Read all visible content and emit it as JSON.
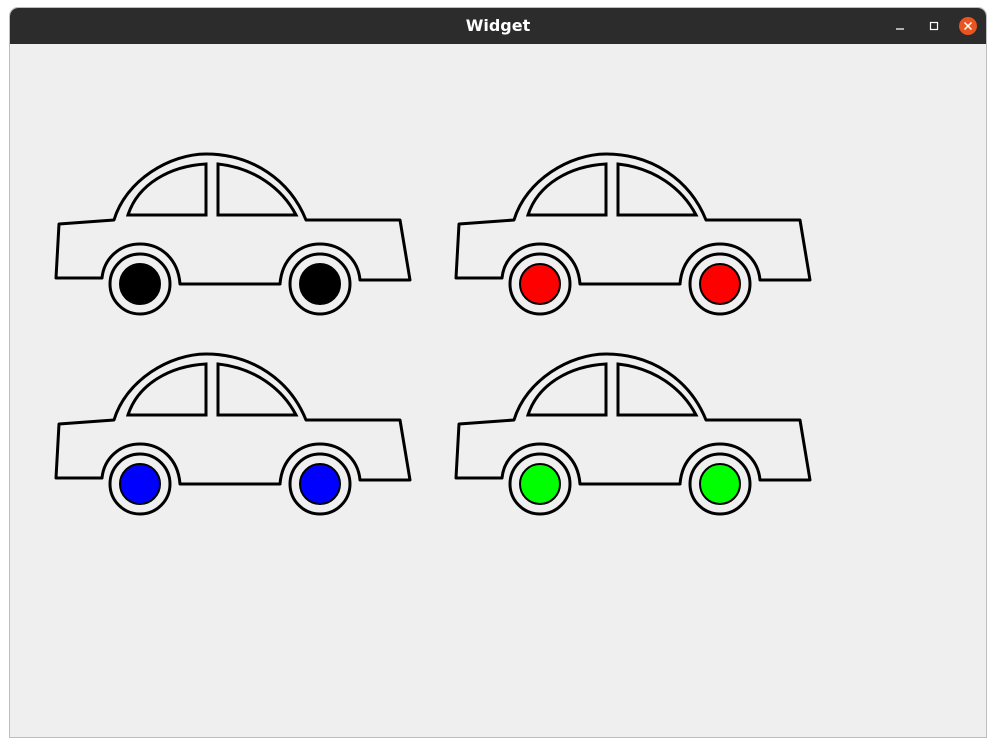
{
  "window": {
    "title": "Widget"
  },
  "controls": {
    "close_color": "#e95420"
  },
  "cars": [
    {
      "wheel_color": "#000000"
    },
    {
      "wheel_color": "#ff0000"
    },
    {
      "wheel_color": "#0000ff"
    },
    {
      "wheel_color": "#00ff00"
    }
  ]
}
